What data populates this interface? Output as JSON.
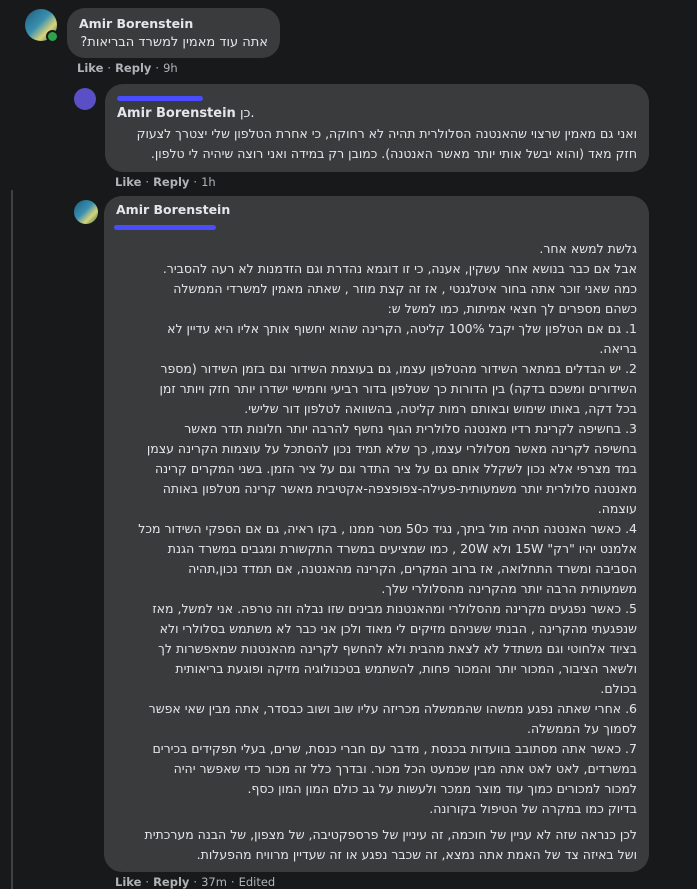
{
  "comments": [
    {
      "author": "Amir Borenstein",
      "text": "אתה עוד מאמין למשרד הבריאות?",
      "actions": {
        "like": "Like",
        "reply": "Reply",
        "time": "9h"
      }
    },
    {
      "mention_name": "Amir Borenstein",
      "mention_suffix": "כן.",
      "text": "ואני גם מאמין שרצוי שהאנטנה הסלולרית תהיה לא רחוקה, כי אחרת הטלפון שלי יצטרך לצעוק\nחזק מאד (והוא יבשל אותי יותר מאשר האנטנה). כמובן רק במידה ואני רוצה שיהיה לי טלפון.",
      "actions": {
        "like": "Like",
        "reply": "Reply",
        "time": "1h"
      }
    },
    {
      "author": "Amir Borenstein",
      "paragraphs": [
        "גלשת למשא אחר.\nאבל אם כבר בנושא אחר עשקין, אענה, כי זו דוגמא נהדרת וגם הזדמנות לא רעה להסביר.\nכמה שאני זוכר אתה בחור איטלגנטי , אז זה קצת מוזר , שאתה מאמין למשרדי הממשלה\nכשהם מספרים לך חצאי אמיתות, כמו למשל ש:\n1. גם אם הטלפון שלך יקבל 100% קליטה, הקרינה שהוא יחשוף אותך אליו היא עדיין לא\nבריאה.\n2. יש הבדלים במתאר השידור מהטלפון עצמו, גם בעוצמת השידור וגם בזמן השידור (מספר\nהשידורים ומשכם בדקה) בין הדורות כך שטלפון בדור רביעי וחמישי ישדרו יותר חזק ויותר זמן\nבכל דקה, באותו שימוש ובאותם רמות קליטה, בהשוואה לטלפון דור שלישי.\n3. בחשיפה לקרינת רדיו מאנטנה סלולרית הגוף נחשף להרבה יותר חלונות תדר מאשר\nבחשיפה לקרינה מאשר מסלולרי עצמו, כך שלא תמיד נכון להסתכל על עוצמות הקרינה עצמן\nבמד מצרפי אלא נכון לשקלל אותם גם על ציר התדר וגם על ציר הזמן. בשני המקרים קרינה\nמאנטנה סלולרית יותר משמעותית-פעילה-צפופצפה-אקטיבית מאשר קרינה מטלפון באותה\nעוצמה.\n4. כאשר האנטנה תהיה מול ביתך, נגיד כ50 מטר ממנו , בקו ראיה, גם אם הספקי השידור מכל\nאלמנט יהיו \"רק\" 15W ולא 20W , כמו שמציעים במשרד התקשורת ומגבים במשרד הגנת\nהסביבה ומשרד התחלואה, אז ברוב המקרים, הקרינה מהאנטנה, אם תמדד נכון,תהיה\nמשמעותית הרבה יותר מהקרינה מהסלולרי שלך.\n5. כאשר נפגעים מקרינה מהסלולרי ומהאנטנות מבינים שזו נבלה וזה טרפה. אני למשל, מאז\nשנפגעתי מהקרינה , הבנתי ששניהם מזיקים לי מאוד ולכן אני כבר לא משתמש בסלולרי ולא\nבציוד אלחוטי וגם משתדל לא לצאת מהבית ולא להחשף לקרינה מהאנטנות שמאפשרות לך\nולשאר הציבור, המכור יותר והמכור פחות, להשתמש בטכנולוגיה מזיקה ופוגעת בריאותית\nבכולם.\n6. אחרי שאתה נפגע ממשהו שהממשלה מכריזה עליו שוב ושוב כבסדר, אתה מבין שאי אפשר\nלסמוך על הממשלה.\n7. כאשר אתה מסתובב בוועדות בכנסת , מדבר עם חברי כנסת, שרים, בעלי תפקידים בכירים\nבמשרדים, לאט לאט אתה מבין שכמעט הכל מכור. ובדרך כלל זה מכור כדי שאפשר יהיה\nלמכור למכורים כמוך עוד מוצר ממכר ולעשות על גב כולם המון המון כסף.\nבדיוק כמו במקרה של הטיפול בקורונה.",
        "לכן כנראה שזה לא עניין של חוכמה, זה עיניין של פרספקטיבה, של מצפון, של הבנה מערכתית\nושל באיזה צד של האמת אתה נמצא, זה שכבר נפגע או זה שעדיין מרוויח מהפעלות."
      ],
      "actions": {
        "like": "Like",
        "reply": "Reply",
        "time": "37m",
        "edited": "Edited"
      }
    }
  ],
  "colors": {
    "background": "#18191a",
    "bubble": "#3a3b3c",
    "accent": "#2d88ff",
    "scribble": "#4a4cff"
  }
}
